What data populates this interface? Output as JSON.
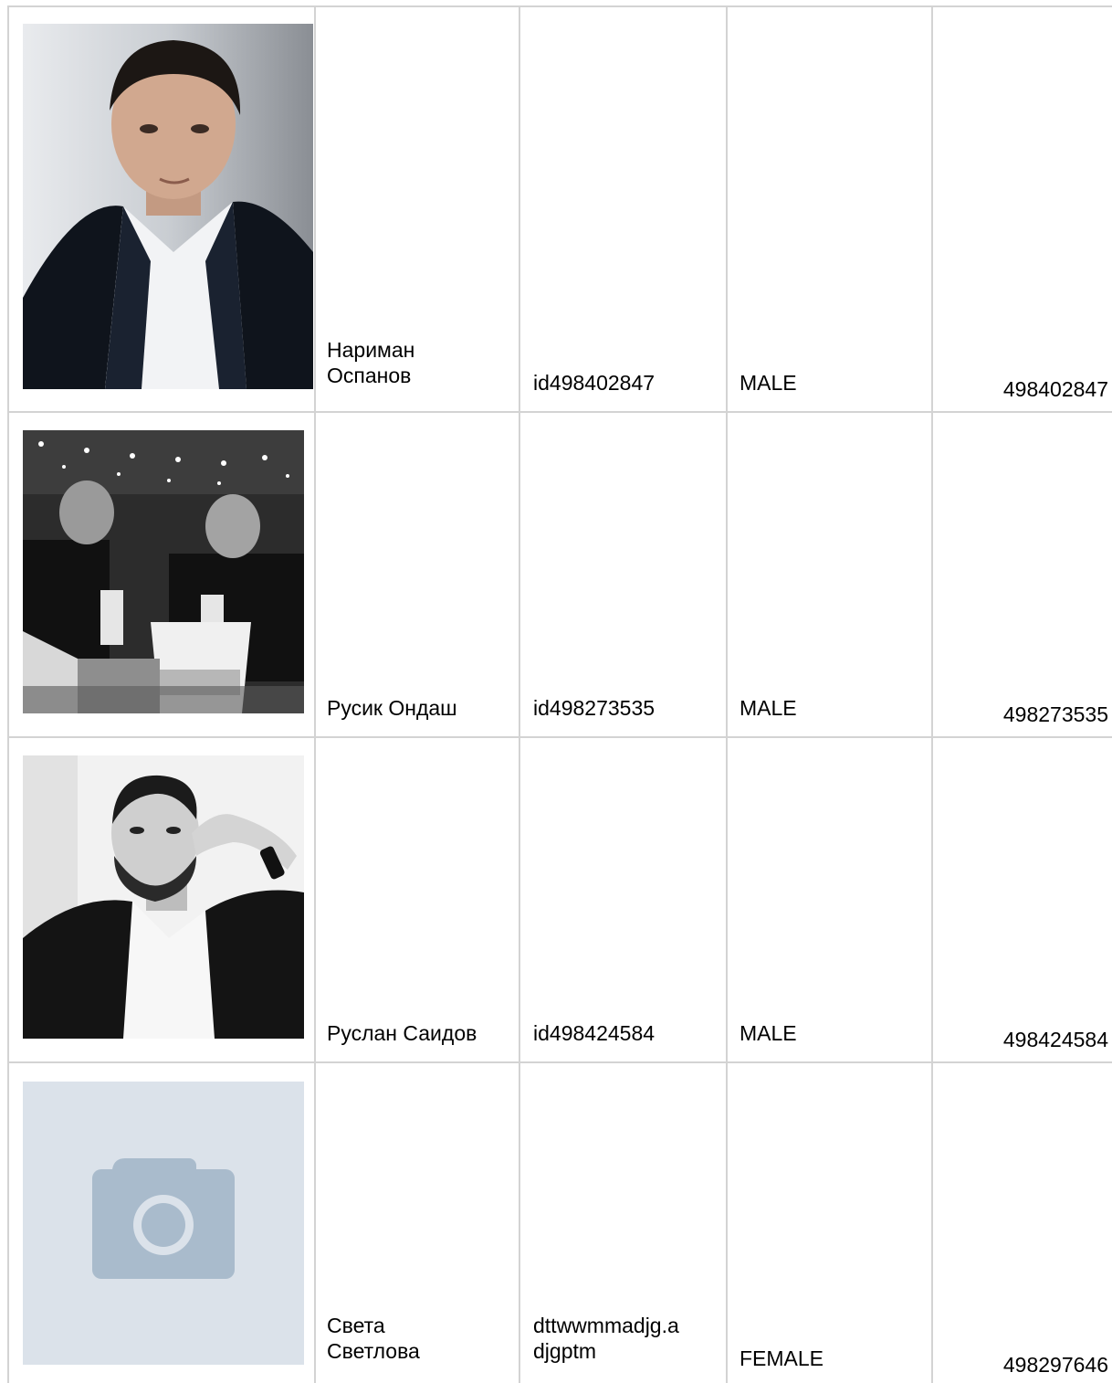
{
  "rows": [
    {
      "name": "Нариман\nОспанов",
      "screen_name": "id498402847",
      "sex": "MALE",
      "user_id": "498402847",
      "photo": "portrait-photo"
    },
    {
      "name": "Русик Ондаш",
      "screen_name": "id498273535",
      "sex": "MALE",
      "user_id": "498273535",
      "photo": "restaurant-group-photo"
    },
    {
      "name": "Руслан Саидов",
      "screen_name": "id498424584",
      "sex": "MALE",
      "user_id": "498424584",
      "photo": "portrait-photo"
    },
    {
      "name": "Света\nСветлова",
      "screen_name": "dttwwmmadjg.a\ndjgptm",
      "sex": "FEMALE",
      "user_id": "498297646",
      "photo": "camera-placeholder-icon"
    }
  ],
  "colors": {
    "grid": "#d3d3d3",
    "placeholder_bg": "#dbe2ea",
    "placeholder_icon": "#a9bbcc"
  }
}
